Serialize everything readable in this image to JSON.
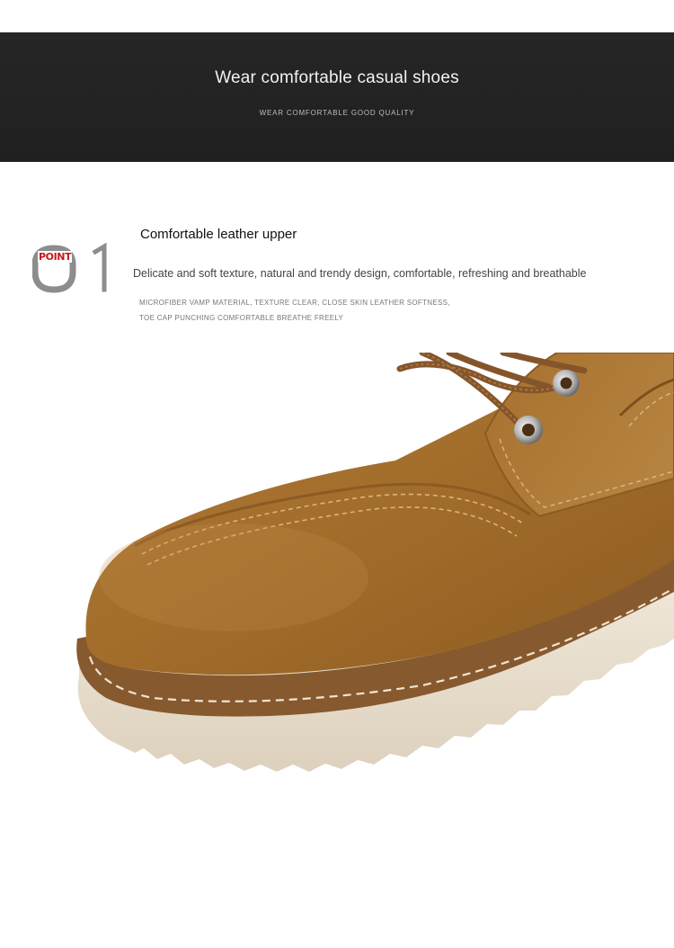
{
  "banner": {
    "title": "Wear comfortable casual shoes",
    "subtitle": "WEAR COMFORTABLE GOOD QUALITY"
  },
  "point": {
    "label": "POINT",
    "number": "01",
    "label_color": "#c8151b"
  },
  "feature": {
    "title": "Comfortable leather upper",
    "description": "Delicate and soft texture, natural and trendy design, comfortable, refreshing and breathable",
    "notes": [
      "MICROFIBER VAMP MATERIAL, TEXTURE CLEAR, CLOSE SKIN LEATHER SOFTNESS,",
      "TOE CAP PUNCHING COMFORTABLE BREATHE FREELY"
    ]
  },
  "product": {
    "image": "brown-suede-shoe-toe-closeup",
    "colors": {
      "suede": "#a87330",
      "sole": "#ece3d4",
      "welt": "#8b5d34",
      "laces": "#8a5a2c"
    }
  }
}
